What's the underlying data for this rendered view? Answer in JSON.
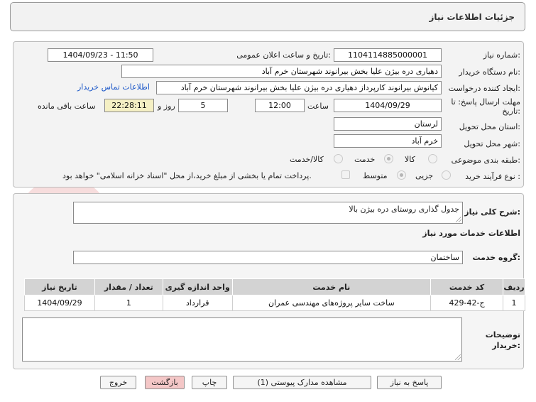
{
  "header": {
    "title": "جزئیات اطلاعات نیاز"
  },
  "form": {
    "need_number_label": "شماره نیاز:",
    "need_number": "1104114885000001",
    "announce_label": "تاریخ و ساعت اعلان عمومی:",
    "announce_value": "1404/09/23 - 11:50",
    "buyer_org_label": "نام دستگاه خریدار:",
    "buyer_org": "دهیاری دره بیژن علیا بخش بیرانوند شهرستان خرم آباد",
    "requester_label": "ایجاد کننده درخواست:",
    "requester": "کیانوش بیرانوند کارپرداز دهیاری دره بیژن علیا بخش بیرانوند شهرستان خرم آباد",
    "contact_link": "اطلاعات تماس خریدار",
    "deadline_label": "مهلت ارسال پاسخ: تا تاریخ:",
    "deadline_date": "1404/09/29",
    "time_label": "ساعت",
    "deadline_time": "12:00",
    "days_value": "5",
    "days_label": "روز و",
    "remaining_time": "22:28:11",
    "remaining_label": "ساعت باقی مانده",
    "province_label": "استان محل تحویل:",
    "province": "لرستان",
    "city_label": "شهر محل تحویل:",
    "city": "خرم آباد",
    "category_label": "طبقه بندی موضوعی:",
    "category_options": [
      "کالا",
      "خدمت",
      "کالا/خدمت"
    ],
    "category_selected": "خدمت",
    "process_label": "نوع فرآیند خرید :",
    "process_options": [
      "جزیی",
      "متوسط"
    ],
    "process_selected": "متوسط",
    "payment_note": "پرداخت تمام یا بخشی از مبلغ خرید،از محل \"اسناد خزانه اسلامی\" خواهد بود."
  },
  "need": {
    "summary_label": "شرح کلی نیاز:",
    "summary": "جدول گذاری روستای دره بیژن بالا",
    "services_title": "اطلاعات خدمات مورد نیاز",
    "service_group_label": "گروه خدمت:",
    "service_group": "ساختمان"
  },
  "table": {
    "headers": [
      "ردیف",
      "کد خدمت",
      "نام خدمت",
      "واحد اندازه گیری",
      "تعداد / مقدار",
      "تاریخ نیاز"
    ],
    "rows": [
      [
        "1",
        "ج-42-429",
        "ساخت سایر پروژه‌های مهندسی عمران",
        "قرارداد",
        "1",
        "1404/09/29"
      ]
    ]
  },
  "buyer_notes_label": "توضیحات خریدار:",
  "buttons": {
    "reply": "پاسخ به نیاز",
    "attachments": "مشاهده مدارک پیوستی (1)",
    "print": "چاپ",
    "back": "بازگشت",
    "exit": "خروج"
  },
  "watermark": "AriaTender.net",
  "colors": {
    "link": "#1a56c8",
    "remaining_bg": "#f5f0c4",
    "back_bg": "#f4c7c7"
  }
}
